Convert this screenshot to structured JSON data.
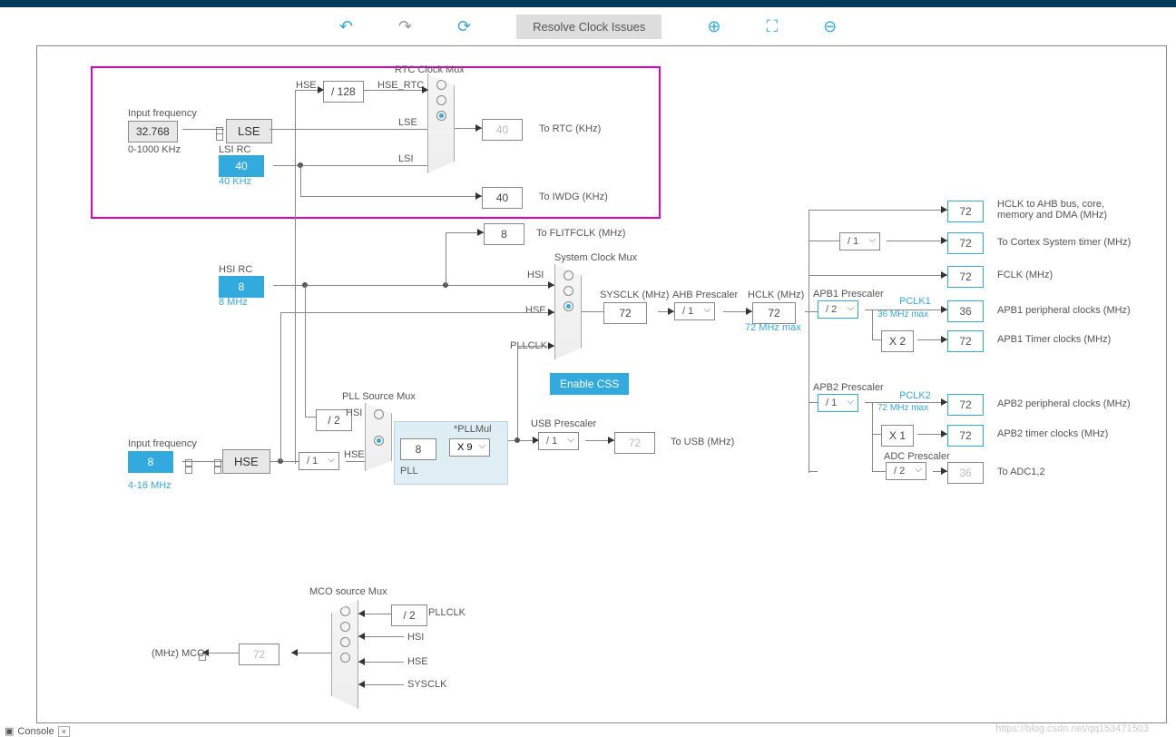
{
  "toolbar": {
    "undo": "↶",
    "redo": "↷",
    "refresh": "⟳",
    "resolve": "Resolve Clock Issues",
    "zoom_in": "⊕",
    "fit": "⛶",
    "zoom_out": "⊖"
  },
  "rtc": {
    "mux_title": "RTC Clock Mux",
    "input_freq_label": "Input frequency",
    "input_freq": "32.768",
    "range": "0-1000 KHz",
    "lse": "LSE",
    "lsi_rc": "LSI RC",
    "lsi_val": "40",
    "lsi_unit": "40 KHz",
    "hse_lbl": "HSE",
    "div128": "/ 128",
    "hse_rtc": "HSE_RTC",
    "lse_lbl": "LSE",
    "lsi_lbl": "LSI",
    "rtc_out": "40",
    "rtc_out_lbl": "To RTC (KHz)",
    "iwdg_out": "40",
    "iwdg_lbl": "To IWDG (KHz)"
  },
  "hsi": {
    "lbl": "HSI RC",
    "val": "8",
    "unit": "8 MHz",
    "hsi": "HSI"
  },
  "sysmux": {
    "title": "System Clock Mux",
    "hse": "HSE",
    "pllclk": "PLLCLK",
    "css": "Enable CSS"
  },
  "flitf": {
    "val": "8",
    "lbl": "To FLITFCLK (MHz)"
  },
  "sysclk": {
    "lbl": "SYSCLK (MHz)",
    "val": "72"
  },
  "ahb": {
    "lbl": "AHB Prescaler",
    "sel": "/ 1",
    "hclk_lbl": "HCLK (MHz)",
    "hclk": "72",
    "max": "72 MHz max"
  },
  "hse": {
    "input_freq_label": "Input frequency",
    "val": "8",
    "range": "4-16 MHz",
    "lbl": "HSE",
    "presc": "/ 1"
  },
  "pll": {
    "src_title": "PLL Source Mux",
    "div2": "/ 2",
    "hsi": "HSI",
    "hse": "HSE",
    "val": "8",
    "mul_lbl": "*PLLMul",
    "mul": "X 9",
    "pll": "PLL"
  },
  "usb": {
    "title": "USB Prescaler",
    "sel": "/ 1",
    "val": "72",
    "lbl": "To USB (MHz)"
  },
  "apb1": {
    "title": "APB1 Prescaler",
    "sel": "/ 2",
    "pclk1": "PCLK1",
    "max": "36 MHz max",
    "periph": "36",
    "periph_lbl": "APB1 peripheral clocks (MHz)",
    "x2": "X 2",
    "timer": "72",
    "timer_lbl": "APB1 Timer clocks (MHz)"
  },
  "apb2": {
    "title": "APB2 Prescaler",
    "sel": "/ 1",
    "pclk2": "PCLK2",
    "max": "72 MHz max",
    "periph": "72",
    "periph_lbl": "APB2 peripheral clocks (MHz)",
    "x1": "X 1",
    "timer": "72",
    "timer_lbl": "APB2 timer clocks (MHz)"
  },
  "adc": {
    "title": "ADC Prescaler",
    "sel": "/ 2",
    "val": "36",
    "lbl": "To ADC1,2"
  },
  "outputs": {
    "hclk1": "72",
    "hclk1_lbl": "HCLK to AHB bus, core, memory and DMA (MHz)",
    "cortex_sel": "/ 1",
    "cortex": "72",
    "cortex_lbl": "To Cortex System timer (MHz)",
    "fclk": "72",
    "fclk_lbl": "FCLK (MHz)"
  },
  "mco": {
    "title": "MCO source Mux",
    "div2": "/ 2",
    "pllclk": "PLLCLK",
    "hsi": "HSI",
    "hse": "HSE",
    "sysclk": "SYSCLK",
    "val": "72",
    "lbl": "(MHz) MCO"
  },
  "bottom": {
    "console": "Console"
  },
  "watermark": "https://blog.csdn.net/qq153471503"
}
